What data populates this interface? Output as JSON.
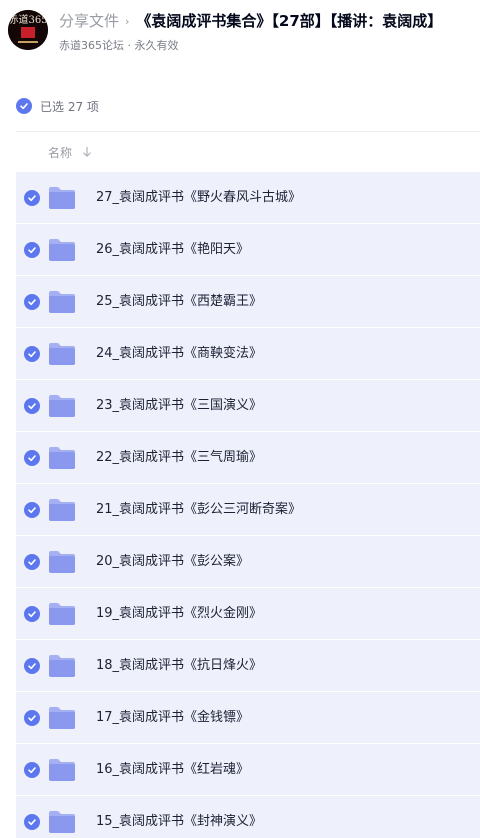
{
  "header": {
    "avatar_text": "赤道365",
    "breadcrumb_root": "分享文件",
    "breadcrumb_separator": "›",
    "title": "《袁阔成评书集合》【27部】【播讲：袁阔成】",
    "subtitle": "赤道365论坛 · 永久有效"
  },
  "selection": {
    "text": "已选 27 项"
  },
  "columns": {
    "name": "名称"
  },
  "colors": {
    "accent": "#5d77ee",
    "row_bg": "#eef0fc",
    "folder": "#8a98ee"
  },
  "files": [
    {
      "name": "27_袁阔成评书《野火春风斗古城》"
    },
    {
      "name": "26_袁阔成评书《艳阳天》"
    },
    {
      "name": "25_袁阔成评书《西楚霸王》"
    },
    {
      "name": "24_袁阔成评书《商鞅变法》"
    },
    {
      "name": "23_袁阔成评书《三国演义》"
    },
    {
      "name": "22_袁阔成评书《三气周瑜》"
    },
    {
      "name": "21_袁阔成评书《彭公三河断奇案》"
    },
    {
      "name": "20_袁阔成评书《彭公案》"
    },
    {
      "name": "19_袁阔成评书《烈火金刚》"
    },
    {
      "name": "18_袁阔成评书《抗日烽火》"
    },
    {
      "name": "17_袁阔成评书《金钱镖》"
    },
    {
      "name": "16_袁阔成评书《红岩魂》"
    },
    {
      "name": "15_袁阔成评书《封神演义》"
    }
  ]
}
